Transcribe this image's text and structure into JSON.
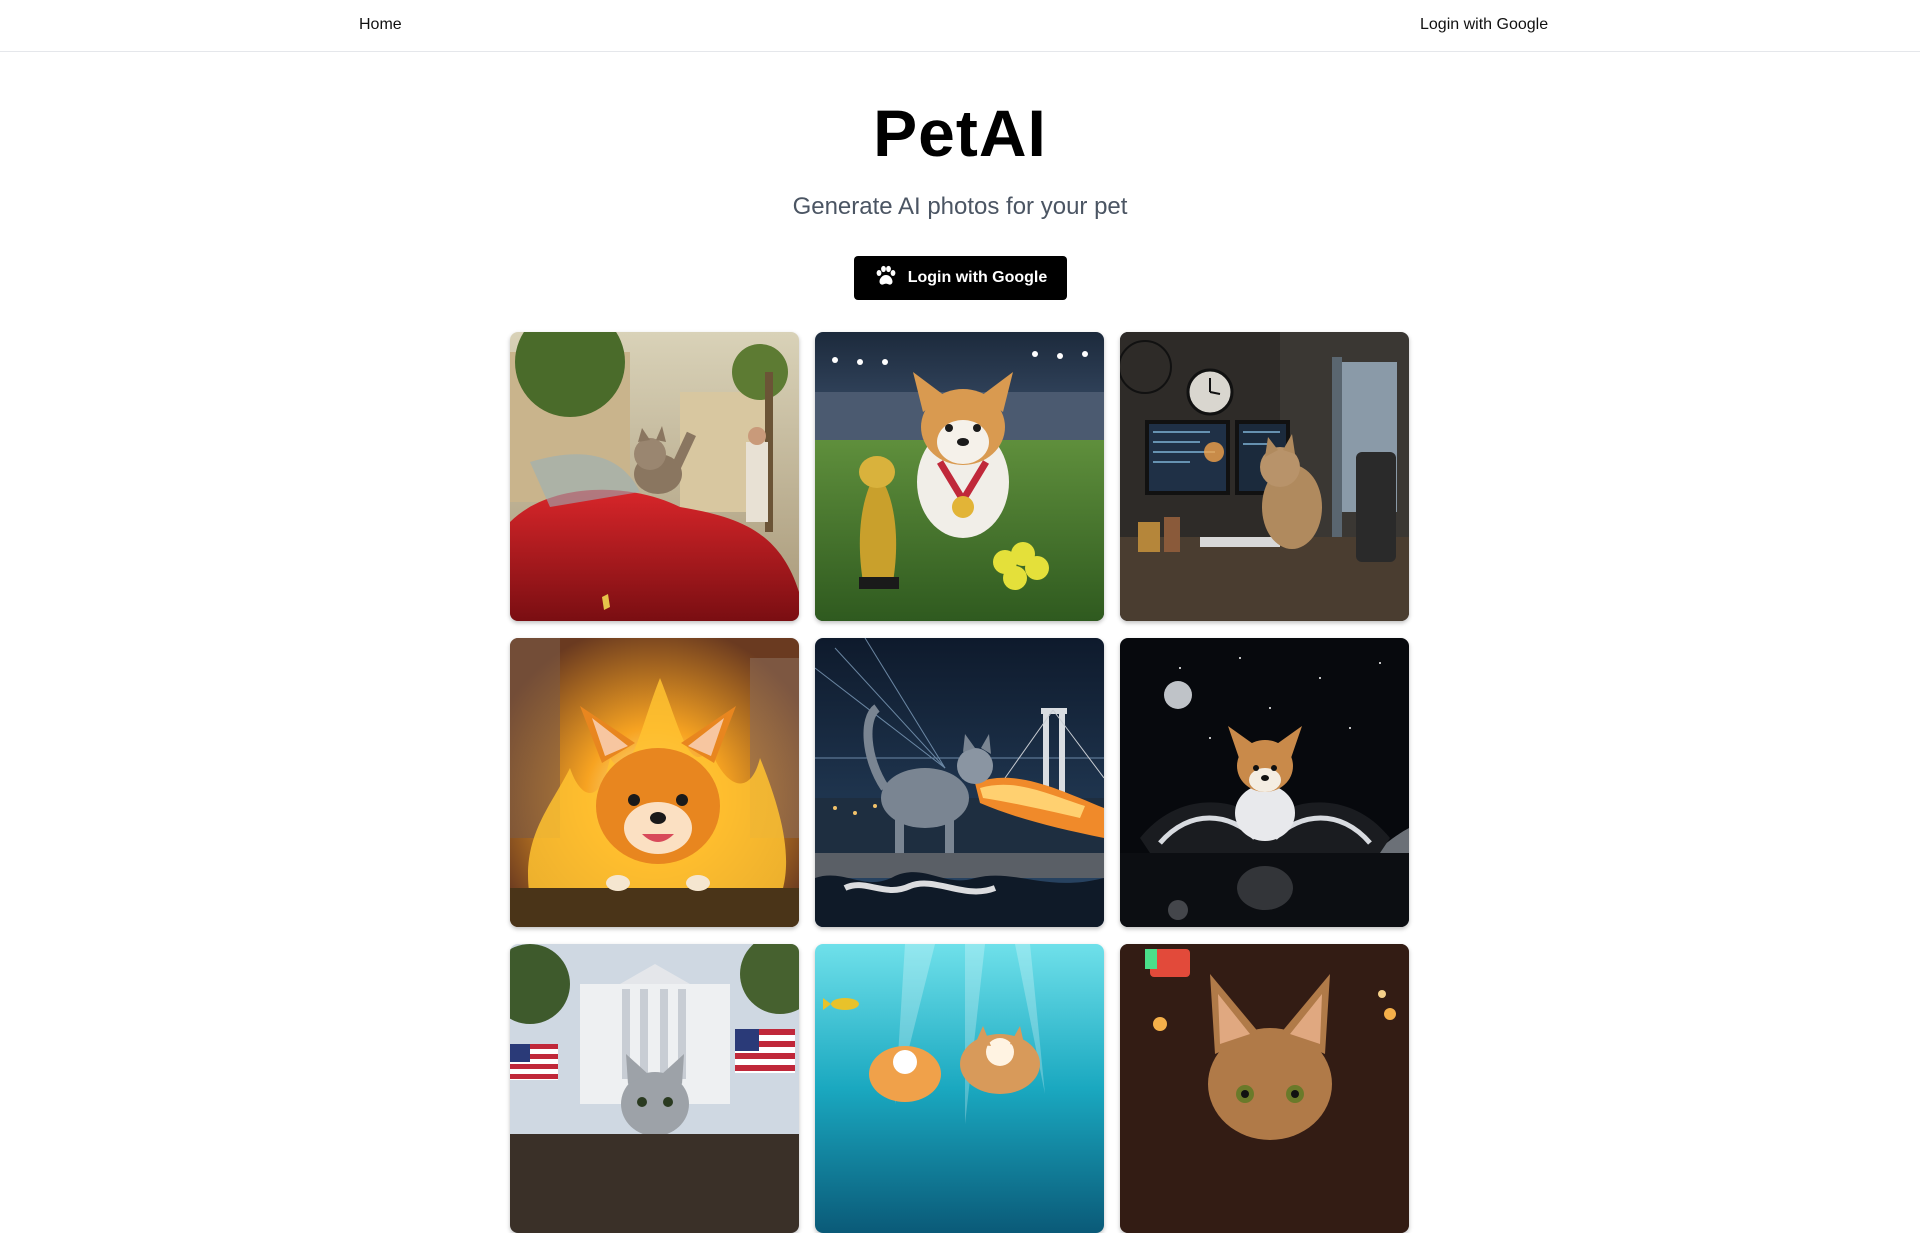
{
  "nav": {
    "home_label": "Home",
    "login_label": "Login with Google"
  },
  "hero": {
    "title": "PetAI",
    "subtitle": "Generate AI photos for your pet",
    "cta_label": "Login with Google",
    "cta_icon": "paw-icon"
  },
  "colors": {
    "cta_background": "#000000",
    "cta_text": "#ffffff",
    "subtitle_text": "#4b5563",
    "nav_border": "#e5e7eb"
  },
  "gallery": {
    "columns": 3,
    "images": [
      {
        "subject": "cat waving from red convertible on palm-lined street"
      },
      {
        "subject": "corgi with trophy and medal in a football stadium"
      },
      {
        "subject": "cat at a computer desk with monitors"
      },
      {
        "subject": "corgi running through fire"
      },
      {
        "subject": "cat breathing fire in front of a bridge at night"
      },
      {
        "subject": "corgi astronaut in a vehicle in space"
      },
      {
        "subject": "cat with American flags in front of the White House"
      },
      {
        "subject": "pets swimming underwater"
      },
      {
        "subject": "cat in a neon-lit bar"
      }
    ]
  }
}
